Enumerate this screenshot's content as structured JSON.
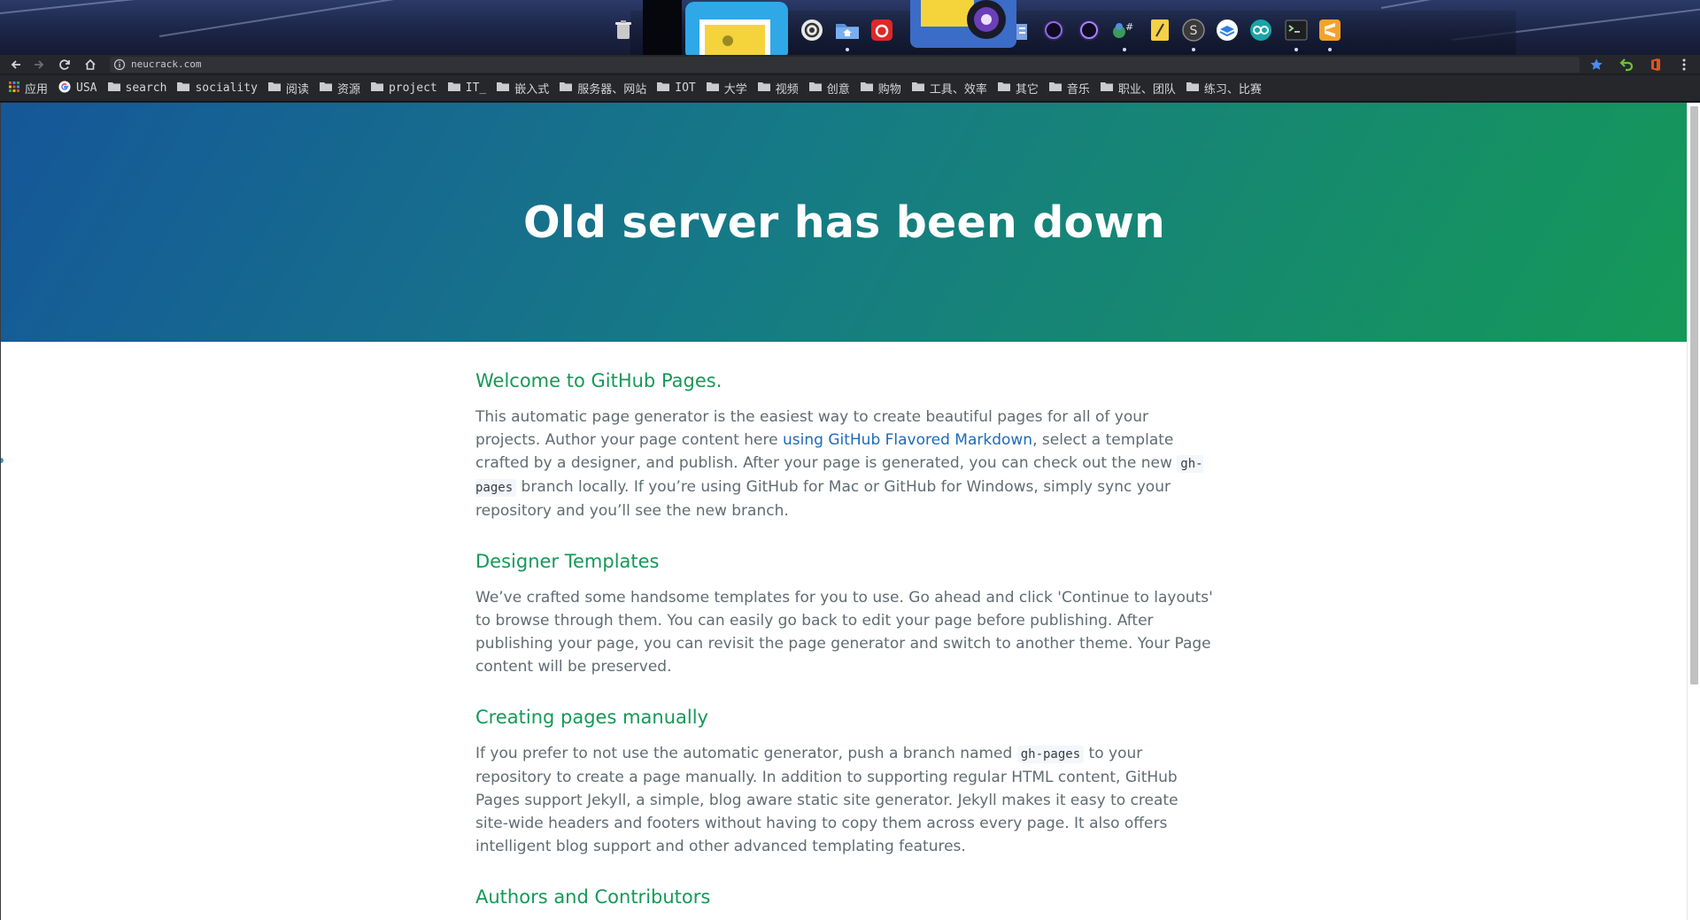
{
  "colors": {
    "hero_start": "#155799",
    "hero_end": "#159957",
    "heading_green": "#159957",
    "link_blue": "#1e6bb8",
    "body_text": "#606c71",
    "star_blue": "#4a8af4"
  },
  "dock": {
    "icons": [
      "trash-icon",
      "image-viewer-icon",
      "ubuntu-circle-icon",
      "home-folder-icon",
      "netease-music-icon",
      "camera-icon",
      "document-icon",
      "eclipse-icon",
      "eclipse-alt-icon",
      "csharp-icon",
      "notes-icon",
      "s-app-icon",
      "layers-app-icon",
      "arduino-icon",
      "terminal-icon",
      "sublime-text-icon"
    ]
  },
  "browser": {
    "url": "neucrack.com",
    "bookmarks": [
      {
        "label": "应用",
        "icon": "apps-grid-icon"
      },
      {
        "label": "USA",
        "icon": "google-icon"
      },
      {
        "label": "search",
        "icon": "folder-icon"
      },
      {
        "label": "sociality",
        "icon": "folder-icon"
      },
      {
        "label": "阅读",
        "icon": "folder-icon"
      },
      {
        "label": "资源",
        "icon": "folder-icon"
      },
      {
        "label": "project",
        "icon": "folder-icon"
      },
      {
        "label": "IT_",
        "icon": "folder-icon"
      },
      {
        "label": "嵌入式",
        "icon": "folder-icon"
      },
      {
        "label": "服务器、网站",
        "icon": "folder-icon"
      },
      {
        "label": "IOT",
        "icon": "folder-icon"
      },
      {
        "label": "大学",
        "icon": "folder-icon"
      },
      {
        "label": "视频",
        "icon": "folder-icon"
      },
      {
        "label": "创意",
        "icon": "folder-icon"
      },
      {
        "label": "购物",
        "icon": "folder-icon"
      },
      {
        "label": "工具、效率",
        "icon": "folder-icon"
      },
      {
        "label": "其它",
        "icon": "folder-icon"
      },
      {
        "label": "音乐",
        "icon": "folder-icon"
      },
      {
        "label": "职业、团队",
        "icon": "folder-icon"
      },
      {
        "label": "练习、比赛",
        "icon": "folder-icon"
      }
    ]
  },
  "page": {
    "hero_title": "Old server has been down",
    "sections": [
      {
        "heading": "Welcome to GitHub Pages.",
        "p1": "This automatic page generator is the easiest way to create beautiful pages for all of your projects. Author your page content here ",
        "link": "using GitHub Flavored Markdown",
        "p2": ", select a template crafted by a designer, and publish. After your page is generated, you can check out the new ",
        "code": "gh-pages",
        "p3": " branch locally. If you’re using GitHub for Mac or GitHub for Windows, simply sync your repository and you’ll see the new branch."
      },
      {
        "heading": "Designer Templates",
        "text": "We’ve crafted some handsome templates for you to use. Go ahead and click 'Continue to layouts' to browse through them. You can easily go back to edit your page before publishing. After publishing your page, you can revisit the page generator and switch to another theme. Your Page content will be preserved."
      },
      {
        "heading": "Creating pages manually",
        "p1": "If you prefer to not use the automatic generator, push a branch named ",
        "code": "gh-pages",
        "p2": " to your repository to create a page manually. In addition to supporting regular HTML content, GitHub Pages support Jekyll, a simple, blog aware static site generator. Jekyll makes it easy to create site-wide headers and footers without having to copy them across every page. It also offers intelligent blog support and other advanced templating features."
      },
      {
        "heading": "Authors and Contributors"
      }
    ]
  }
}
